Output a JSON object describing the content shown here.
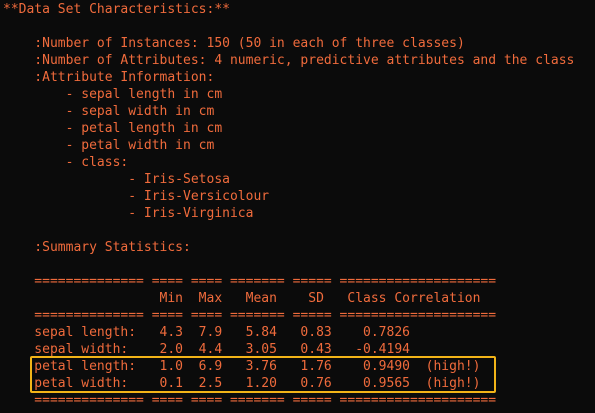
{
  "terminal": {
    "lines": [
      "**Data Set Characteristics:**",
      "",
      "    :Number of Instances: 150 (50 in each of three classes)",
      "    :Number of Attributes: 4 numeric, predictive attributes and the class",
      "    :Attribute Information:",
      "        - sepal length in cm",
      "        - sepal width in cm",
      "        - petal length in cm",
      "        - petal width in cm",
      "        - class:",
      "                - Iris-Setosa",
      "                - Iris-Versicolour",
      "                - Iris-Virginica",
      "",
      "    :Summary Statistics:",
      "",
      "    ============== ==== ==== ======= ===== ====================",
      "                    Min  Max   Mean    SD   Class Correlation",
      "    ============== ==== ==== ======= ===== ====================",
      "    sepal length:   4.3  7.9   5.84   0.83    0.7826",
      "    sepal width:    2.0  4.4   3.05   0.43   -0.4194",
      "    petal length:   1.0  6.9   3.76   1.76    0.9490  (high!)",
      "    petal width:    0.1  2.5   1.20   0.76    0.9565  (high!)",
      "    ============== ==== ==== ======= ===== ===================="
    ]
  },
  "colors": {
    "background": "#0b0b0b",
    "text": "#f06b3c",
    "highlight_border": "#f2b418"
  }
}
